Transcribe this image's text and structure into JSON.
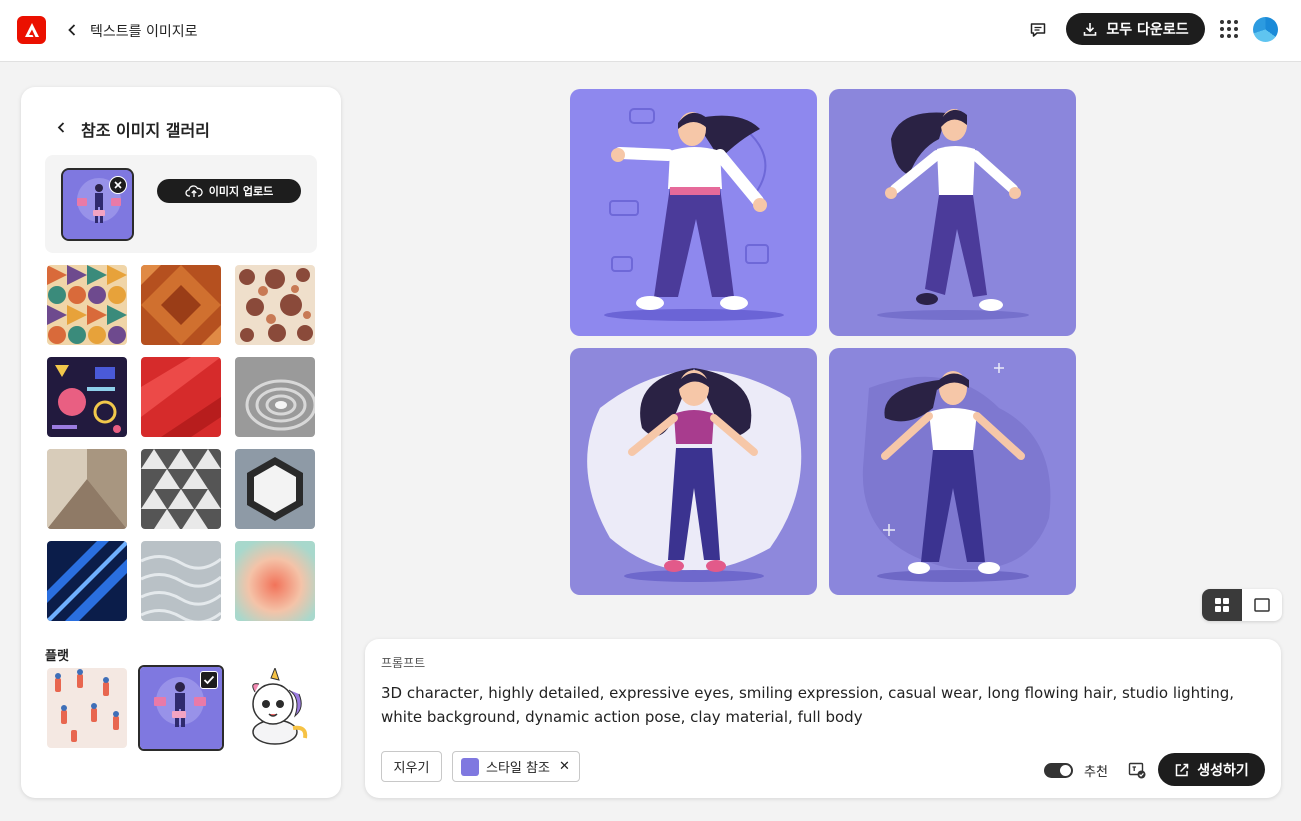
{
  "header": {
    "title": "텍스트를 이미지로",
    "download_all_label": "모두 다운로드"
  },
  "sidebar": {
    "title": "참조 이미지 갤러리",
    "upload_label": "이미지 업로드",
    "flat_section_label": "플랫"
  },
  "prompt": {
    "label": "프롬프트",
    "text": "3D character, highly detailed, expressive eyes, smiling expression, casual wear, long flowing hair, studio lighting, white background, dynamic action pose, clay material, full body",
    "clear_label": "지우기",
    "style_chip_label": "스타일 참조",
    "recommend_label": "추천",
    "generate_label": "생성하기"
  },
  "icons": {
    "app_logo": "adobe-logo-icon",
    "feedback": "feedback-icon",
    "download": "download-icon",
    "apps": "apps-grid-icon",
    "upload": "cloud-upload-icon",
    "generate": "generate-icon"
  },
  "colors": {
    "accent": "#1d1d1d",
    "brand": "#eb1000",
    "result_background": "#8b86dc"
  }
}
